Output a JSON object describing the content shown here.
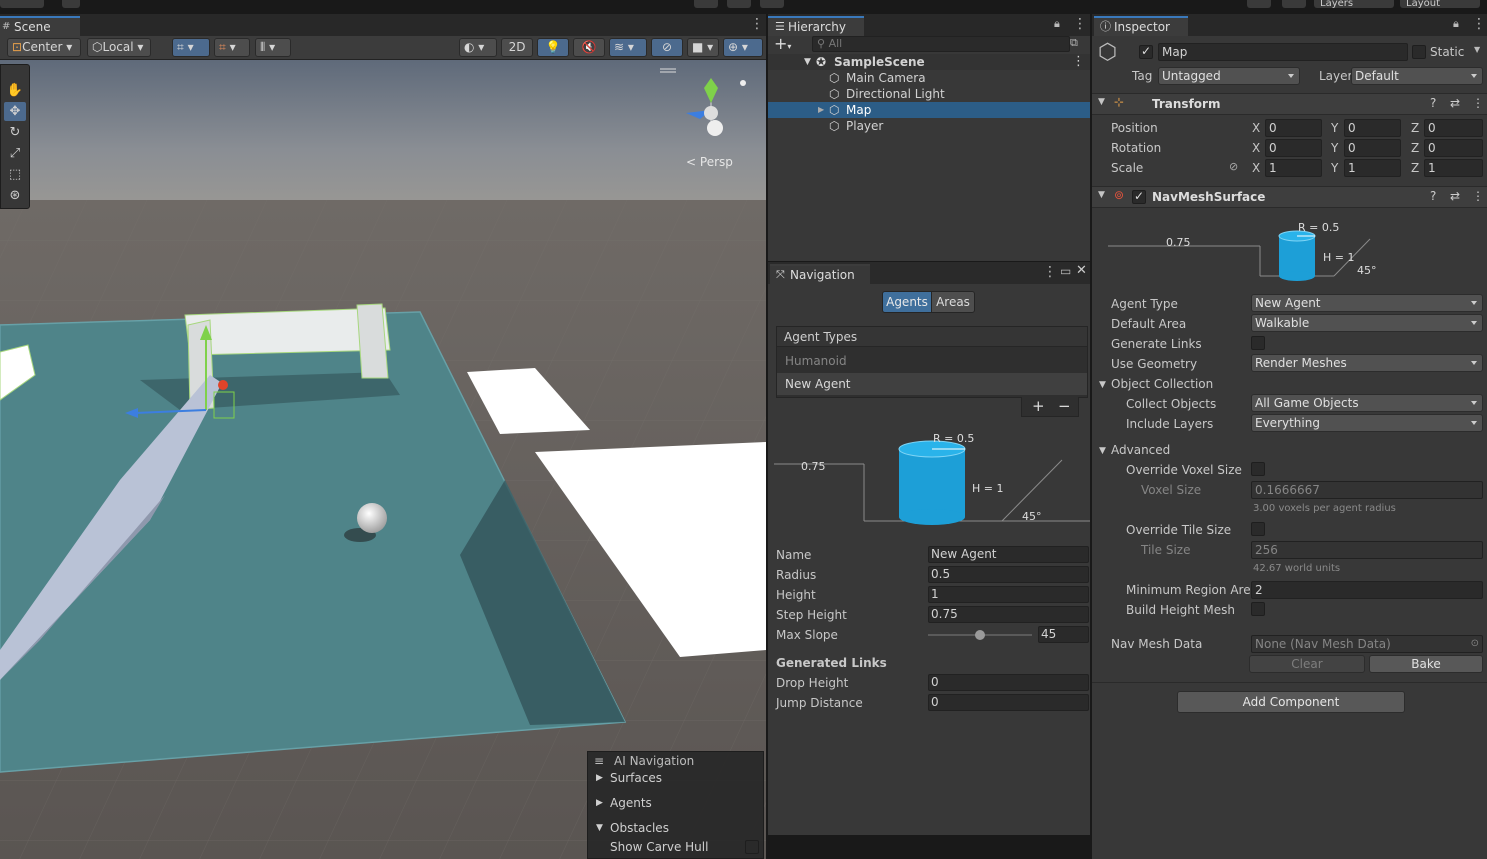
{
  "topbar": {
    "layers_label": "Layers",
    "layout_label": "Layout"
  },
  "scene": {
    "tab_label": "Scene",
    "toolbar": {
      "pivot_label": "Center",
      "space_label": "Local",
      "mode_2d_label": "2D"
    },
    "persp_label": "Persp",
    "overlay": {
      "title": "AI Navigation",
      "items": [
        "Surfaces",
        "Agents",
        "Obstacles"
      ],
      "show_carve_hull_label": "Show Carve Hull"
    }
  },
  "hierarchy": {
    "tab_label": "Hierarchy",
    "search_placeholder": "All",
    "scene_name": "SampleScene",
    "objects": [
      "Main Camera",
      "Directional Light",
      "Map",
      "Player"
    ],
    "selected": "Map"
  },
  "navigation": {
    "tab_label": "Navigation",
    "tabs": [
      "Agents",
      "Areas"
    ],
    "active_tab": "Agents",
    "agent_types_header": "Agent Types",
    "agent_types": [
      "Humanoid",
      "New Agent"
    ],
    "diagram": {
      "radius_label": "R = 0.5",
      "step_label": "0.75",
      "height_label": "H = 1",
      "slope_label": "45°"
    },
    "fields": {
      "name_label": "Name",
      "name_value": "New Agent",
      "radius_label": "Radius",
      "radius_value": "0.5",
      "height_label": "Height",
      "height_value": "1",
      "step_label": "Step Height",
      "step_value": "0.75",
      "slope_label": "Max Slope",
      "slope_value": "45",
      "slope_fraction": 0.5
    },
    "generated_links": {
      "header": "Generated Links",
      "drop_label": "Drop Height",
      "drop_value": "0",
      "jump_label": "Jump Distance",
      "jump_value": "0"
    }
  },
  "inspector": {
    "tab_label": "Inspector",
    "object_name": "Map",
    "static_label": "Static",
    "tag_label": "Tag",
    "tag_value": "Untagged",
    "layer_label": "Layer",
    "layer_value": "Default",
    "transform": {
      "title": "Transform",
      "position_label": "Position",
      "rotation_label": "Rotation",
      "scale_label": "Scale",
      "position": {
        "x": "0",
        "y": "0",
        "z": "0"
      },
      "rotation": {
        "x": "0",
        "y": "0",
        "z": "0"
      },
      "scale": {
        "x": "1",
        "y": "1",
        "z": "1"
      }
    },
    "navmesh": {
      "title": "NavMeshSurface",
      "diagram": {
        "radius_label": "R = 0.5",
        "step_label": "0.75",
        "height_label": "H = 1",
        "slope_label": "45°"
      },
      "agent_type_label": "Agent Type",
      "agent_type_value": "New Agent",
      "default_area_label": "Default Area",
      "default_area_value": "Walkable",
      "generate_links_label": "Generate Links",
      "use_geometry_label": "Use Geometry",
      "use_geometry_value": "Render Meshes",
      "object_collection_label": "Object Collection",
      "collect_objects_label": "Collect Objects",
      "collect_objects_value": "All Game Objects",
      "include_layers_label": "Include Layers",
      "include_layers_value": "Everything",
      "advanced_label": "Advanced",
      "override_voxel_label": "Override Voxel Size",
      "voxel_size_label": "Voxel Size",
      "voxel_size_value": "0.1666667",
      "voxel_hint": "3.00 voxels per agent radius",
      "override_tile_label": "Override Tile Size",
      "tile_size_label": "Tile Size",
      "tile_size_value": "256",
      "tile_hint": "42.67 world units",
      "min_region_label": "Minimum Region Area",
      "min_region_value": "2",
      "build_height_label": "Build Height Mesh",
      "nav_data_label": "Nav Mesh Data",
      "nav_data_value": "None (Nav Mesh Data)",
      "clear_label": "Clear",
      "bake_label": "Bake"
    },
    "add_component_label": "Add Component"
  }
}
